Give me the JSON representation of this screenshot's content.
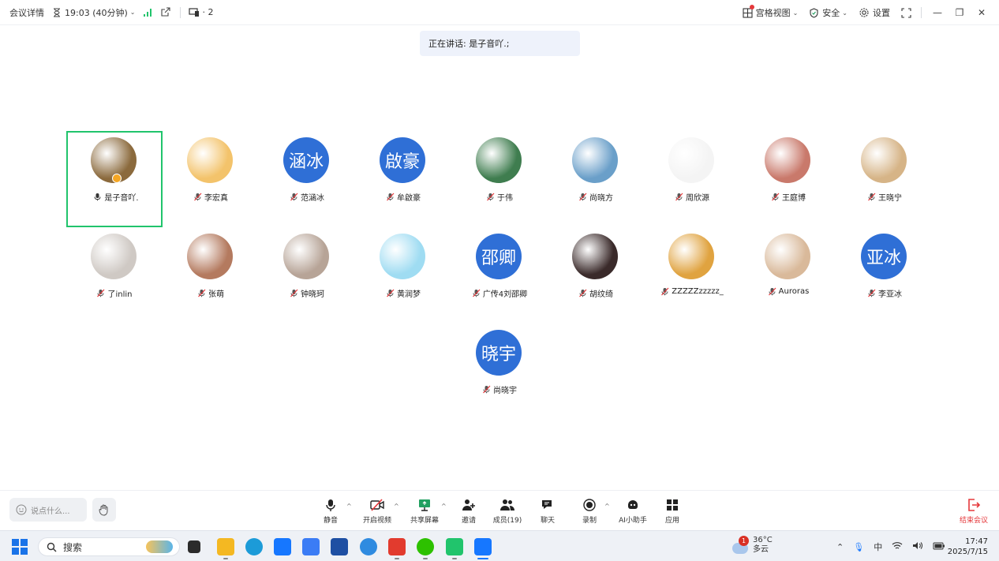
{
  "topbar": {
    "meeting_details": "会议详情",
    "duration": "19:03 (40分钟)",
    "devices_count": "· 2",
    "view": "宫格视图",
    "security": "安全",
    "settings": "设置"
  },
  "speaking": {
    "label": "正在讲话: 是子音吖.;"
  },
  "participants": [
    {
      "name": "是子音吖.",
      "avatar_text": "",
      "avatar_color": "#8b6a3d",
      "mic": "on",
      "active": true
    },
    {
      "name": "李宏真",
      "avatar_text": "",
      "avatar_color": "#f3c36b",
      "mic": "muted"
    },
    {
      "name": "范涵冰",
      "avatar_text": "涵冰",
      "avatar_color": "#2f6fd6",
      "mic": "muted"
    },
    {
      "name": "牟啟豪",
      "avatar_text": "啟豪",
      "avatar_color": "#2f6fd6",
      "mic": "muted"
    },
    {
      "name": "于伟",
      "avatar_text": "",
      "avatar_color": "#3f7d4f",
      "mic": "muted"
    },
    {
      "name": "尚晓方",
      "avatar_text": "",
      "avatar_color": "#6a9fc9",
      "mic": "muted"
    },
    {
      "name": "周欣源",
      "avatar_text": "",
      "avatar_color": "#f4f4f4",
      "mic": "muted"
    },
    {
      "name": "王庭博",
      "avatar_text": "",
      "avatar_color": "#c9796b",
      "mic": "muted"
    },
    {
      "name": "王晓宁",
      "avatar_text": "",
      "avatar_color": "#d6b487",
      "mic": "muted"
    },
    {
      "name": "了inlin",
      "avatar_text": "",
      "avatar_color": "#cfc9c4",
      "mic": "muted"
    },
    {
      "name": "张萌",
      "avatar_text": "",
      "avatar_color": "#b47a5f",
      "mic": "muted"
    },
    {
      "name": "钟晓珂",
      "avatar_text": "",
      "avatar_color": "#b7a497",
      "mic": "muted"
    },
    {
      "name": "黄润梦",
      "avatar_text": "",
      "avatar_color": "#9fdcf2",
      "mic": "muted"
    },
    {
      "name": "广传4刘邵卿",
      "avatar_text": "邵卿",
      "avatar_color": "#2f6fd6",
      "mic": "muted"
    },
    {
      "name": "胡纹绮",
      "avatar_text": "",
      "avatar_color": "#3a2a2a",
      "mic": "muted"
    },
    {
      "name": "ZZZZZzzzzz_",
      "avatar_text": "",
      "avatar_color": "#e0a340",
      "mic": "muted"
    },
    {
      "name": "Auroras",
      "avatar_text": "",
      "avatar_color": "#d9b99a",
      "mic": "muted"
    },
    {
      "name": "李亚冰",
      "avatar_text": "亚冰",
      "avatar_color": "#2f6fd6",
      "mic": "muted"
    },
    {
      "name": "尚晓宇",
      "avatar_text": "晓宇",
      "avatar_color": "#2f6fd6",
      "mic": "muted"
    }
  ],
  "toolbar": {
    "chat_placeholder": "说点什么...",
    "mute": "静音",
    "video": "开启视频",
    "share": "共享屏幕",
    "invite": "邀请",
    "members": "成员(19)",
    "chat": "聊天",
    "record": "录制",
    "ai": "AI小助手",
    "apps": "应用",
    "end": "结束会议"
  },
  "taskbar": {
    "search": "搜索",
    "weather_temp": "36°C",
    "weather_desc": "多云",
    "weather_badge": "1",
    "time": "17:47",
    "date": "2025/7/15"
  },
  "colors": {
    "accent": "#2f6fd6",
    "active_border": "#21c46c",
    "end_red": "#e5383b"
  }
}
